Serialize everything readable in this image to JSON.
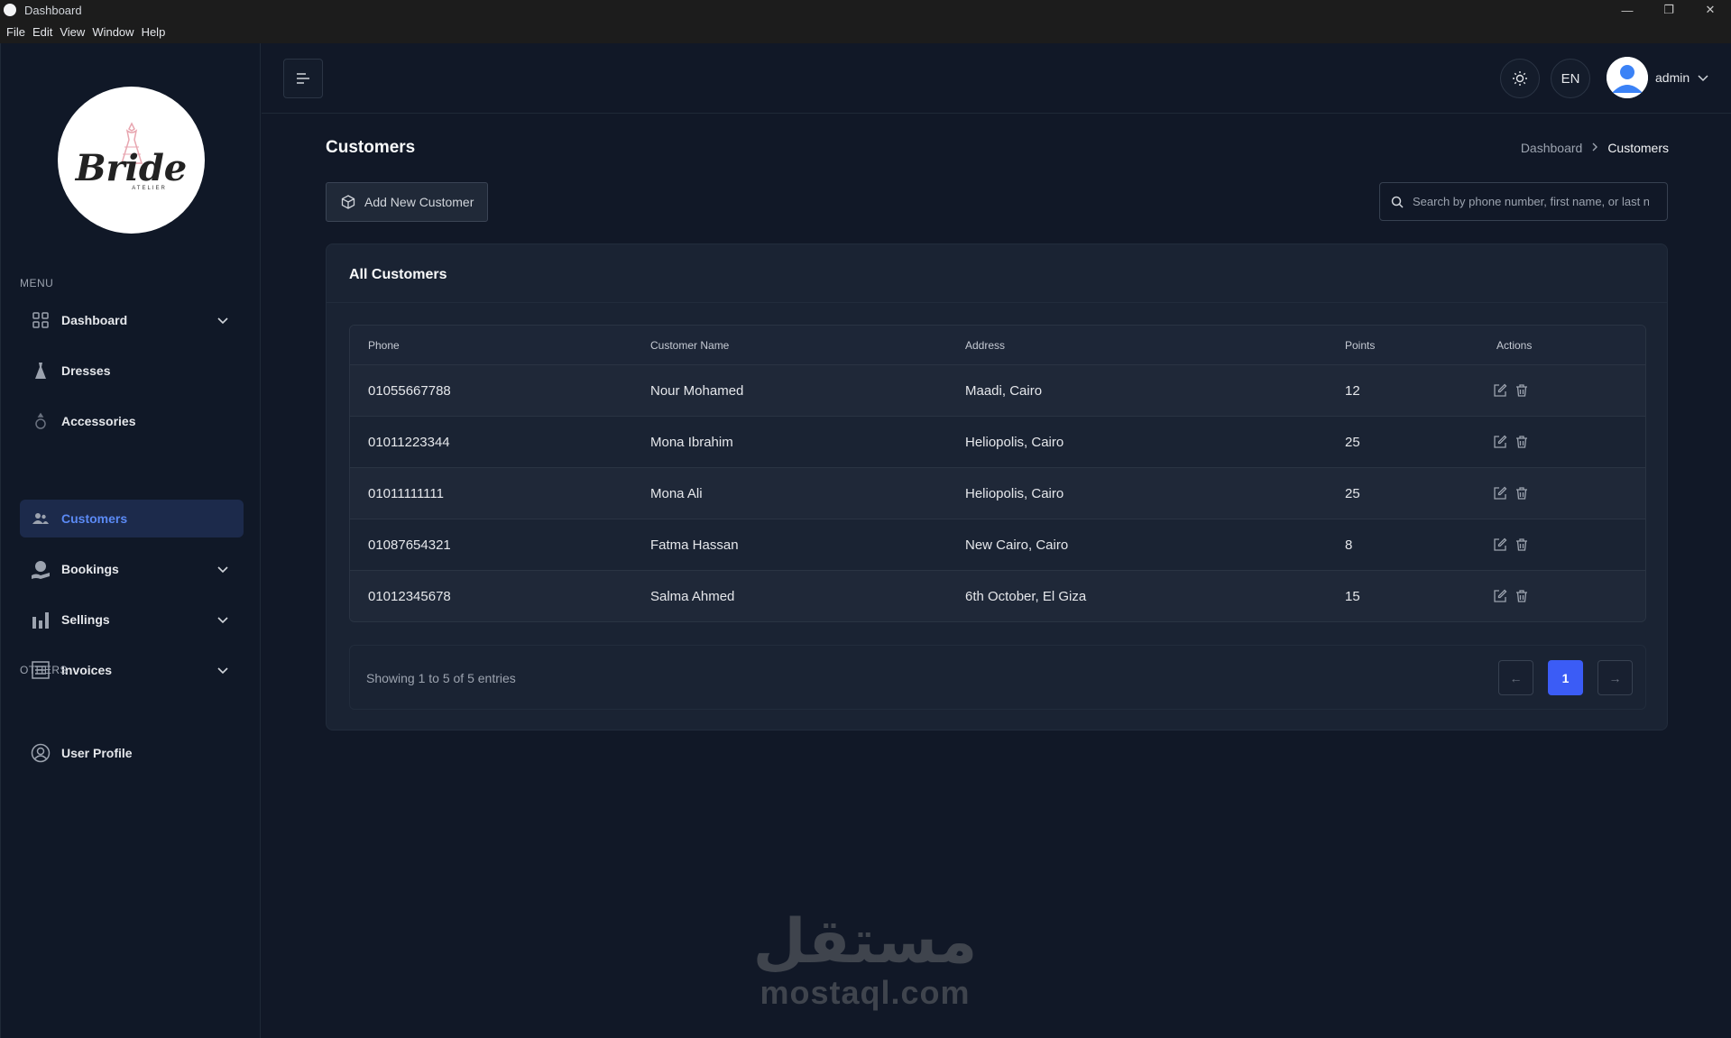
{
  "window": {
    "title": "Dashboard",
    "controls": [
      "—",
      "❐",
      "✕"
    ]
  },
  "menubar": [
    "File",
    "Edit",
    "View",
    "Window",
    "Help"
  ],
  "logo": {
    "brand": "Bride",
    "sub": "ATELIER"
  },
  "sidebar": {
    "menu_label": "MENU",
    "others_label": "OTHERS",
    "items": [
      {
        "label": "Dashboard",
        "icon": "grid-icon",
        "has_chevron": true,
        "active": false
      },
      {
        "label": "Dresses",
        "icon": "dress-icon",
        "has_chevron": false,
        "active": false
      },
      {
        "label": "Accessories",
        "icon": "ring-icon",
        "has_chevron": false,
        "active": false
      },
      {
        "label": "Customers",
        "icon": "users-icon",
        "has_chevron": false,
        "active": true
      },
      {
        "label": "Bookings",
        "icon": "booking-icon",
        "has_chevron": true,
        "active": false
      },
      {
        "label": "Sellings",
        "icon": "sellings-icon",
        "has_chevron": true,
        "active": false
      },
      {
        "label": "Invoices",
        "icon": "invoice-icon",
        "has_chevron": true,
        "active": false
      }
    ],
    "others": [
      {
        "label": "User Profile",
        "icon": "user-circle-icon"
      }
    ]
  },
  "header": {
    "lang": "EN",
    "user_name": "admin"
  },
  "page": {
    "title": "Customers",
    "breadcrumb": {
      "parent": "Dashboard",
      "current": "Customers"
    },
    "add_button": "Add New Customer",
    "search_placeholder": "Search by phone number, first name, or last name"
  },
  "card": {
    "title": "All Customers",
    "columns": [
      "Phone",
      "Customer Name",
      "Address",
      "Points",
      "Actions"
    ],
    "rows": [
      {
        "phone": "01055667788",
        "name": "Nour Mohamed",
        "address": "Maadi, Cairo",
        "points": "12"
      },
      {
        "phone": "01011223344",
        "name": "Mona Ibrahim",
        "address": "Heliopolis, Cairo",
        "points": "25"
      },
      {
        "phone": "01011111111",
        "name": "Mona Ali",
        "address": "Heliopolis, Cairo",
        "points": "25"
      },
      {
        "phone": "01087654321",
        "name": "Fatma Hassan",
        "address": "New Cairo, Cairo",
        "points": "8"
      },
      {
        "phone": "01012345678",
        "name": "Salma Ahmed",
        "address": "6th October, El Giza",
        "points": "15"
      }
    ],
    "showing": "Showing 1 to 5 of 5 entries",
    "pagination": {
      "prev": "←",
      "current": "1",
      "next": "→"
    }
  },
  "watermark": {
    "arabic": "مستقل",
    "latin": "mostaql.com"
  },
  "colors": {
    "accent": "#3b5cf6",
    "active_nav_text": "#5b8af5",
    "background": "#111827"
  }
}
